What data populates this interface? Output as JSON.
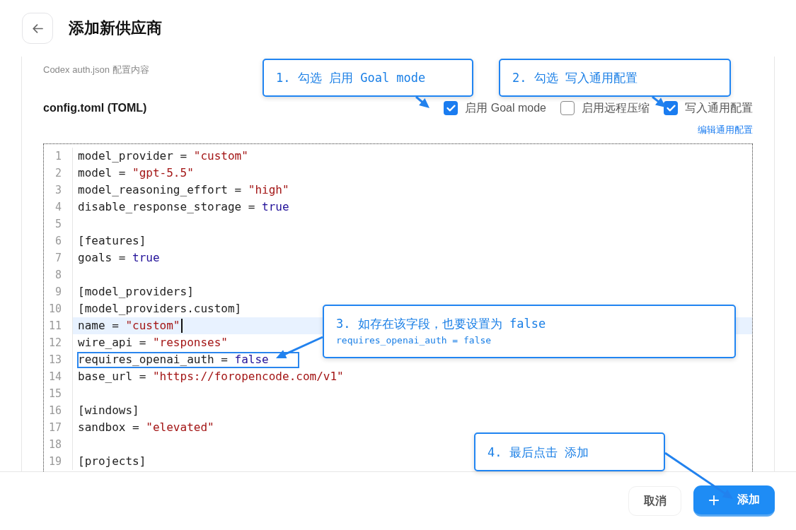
{
  "header": {
    "title": "添加新供应商"
  },
  "form": {
    "auth_label": "Codex auth.json 配置内容",
    "config_title": "config.toml (TOML)",
    "options": [
      {
        "label": "启用 Goal mode",
        "checked": true
      },
      {
        "label": "启用远程压缩",
        "checked": false
      },
      {
        "label": "写入通用配置",
        "checked": true
      }
    ],
    "edit_link": "编辑通用配置",
    "editor": {
      "lines": [
        {
          "number": "1",
          "active": false,
          "framed": false,
          "tokens": [
            {
              "kind": "plain",
              "text": "model_provider = "
            },
            {
              "kind": "string",
              "text": "\"custom\""
            }
          ]
        },
        {
          "number": "2",
          "active": false,
          "framed": false,
          "tokens": [
            {
              "kind": "plain",
              "text": "model = "
            },
            {
              "kind": "string",
              "text": "\"gpt-5.5\""
            }
          ]
        },
        {
          "number": "3",
          "active": false,
          "framed": false,
          "tokens": [
            {
              "kind": "plain",
              "text": "model_reasoning_effort = "
            },
            {
              "kind": "string",
              "text": "\"high\""
            }
          ]
        },
        {
          "number": "4",
          "active": false,
          "framed": false,
          "tokens": [
            {
              "kind": "plain",
              "text": "disable_response_storage = "
            },
            {
              "kind": "atom",
              "text": "true"
            }
          ]
        },
        {
          "number": "5",
          "active": false,
          "framed": false
        },
        {
          "number": "6",
          "active": false,
          "framed": false,
          "tokens": [
            {
              "kind": "plain",
              "text": "[features]"
            }
          ]
        },
        {
          "number": "7",
          "active": false,
          "framed": false,
          "tokens": [
            {
              "kind": "plain",
              "text": "goals = "
            },
            {
              "kind": "atom",
              "text": "true"
            }
          ]
        },
        {
          "number": "8",
          "active": false,
          "framed": false
        },
        {
          "number": "9",
          "active": false,
          "framed": false,
          "tokens": [
            {
              "kind": "plain",
              "text": "[model_providers]"
            }
          ]
        },
        {
          "number": "10",
          "active": false,
          "framed": false,
          "tokens": [
            {
              "kind": "plain",
              "text": "[model_providers.custom]"
            }
          ]
        },
        {
          "number": "11",
          "active": true,
          "framed": false,
          "tokens": [
            {
              "kind": "plain",
              "text": "name = "
            },
            {
              "kind": "string",
              "text": "\"custom\""
            }
          ]
        },
        {
          "number": "12",
          "active": false,
          "framed": false,
          "tokens": [
            {
              "kind": "plain",
              "text": "wire_api = "
            },
            {
              "kind": "string",
              "text": "\"responses\""
            }
          ]
        },
        {
          "number": "13",
          "active": false,
          "framed": true,
          "tokens": [
            {
              "kind": "plain",
              "text": "requires_openai_auth = "
            },
            {
              "kind": "atom",
              "text": "false"
            }
          ]
        },
        {
          "number": "14",
          "active": false,
          "framed": false,
          "tokens": [
            {
              "kind": "plain",
              "text": "base_url = "
            },
            {
              "kind": "string",
              "text": "\"https://foropencode.com/v1\""
            }
          ]
        },
        {
          "number": "15",
          "active": false,
          "framed": false
        },
        {
          "number": "16",
          "active": false,
          "framed": false,
          "tokens": [
            {
              "kind": "plain",
              "text": "[windows]"
            }
          ]
        },
        {
          "number": "17",
          "active": false,
          "framed": false,
          "tokens": [
            {
              "kind": "plain",
              "text": "sandbox = "
            },
            {
              "kind": "string",
              "text": "\"elevated\""
            }
          ]
        },
        {
          "number": "18",
          "active": false,
          "framed": false
        },
        {
          "number": "19",
          "active": false,
          "framed": false,
          "tokens": [
            {
              "kind": "plain",
              "text": "[projects]"
            }
          ]
        }
      ]
    }
  },
  "footer": {
    "buttons": [
      {
        "label": "取消",
        "kind": "secondary"
      },
      {
        "label": "添加",
        "kind": "primary"
      }
    ]
  },
  "annotations": [
    {
      "text": "1. 勾选 启用 Goal mode"
    },
    {
      "text": "2. 勾选 写入通用配置"
    },
    {
      "text": "3. 如存在该字段，也要设置为 false",
      "note": "requires_openai_auth = false"
    },
    {
      "text": "4. 最后点击 添加"
    }
  ]
}
